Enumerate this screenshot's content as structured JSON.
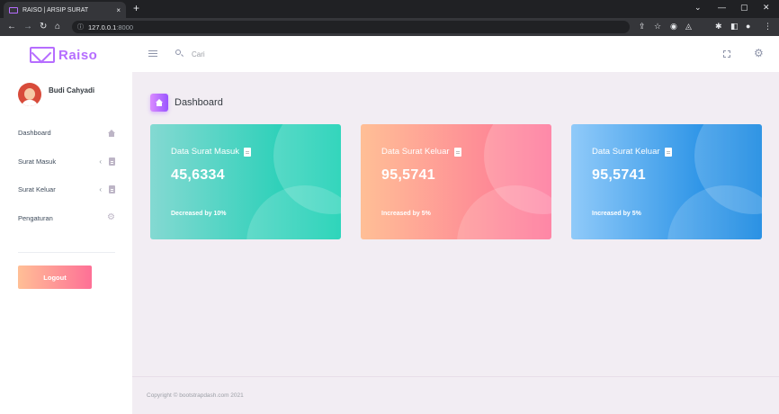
{
  "browser": {
    "tab_title": "RAISO | ARSIP SURAT",
    "tab_close": "×",
    "new_tab": "+",
    "url_host": "127.0.0.1",
    "url_port": ":8000",
    "window_controls": [
      "⌄",
      "—",
      "▢",
      "✕"
    ]
  },
  "sidebar": {
    "brand": "Raiso",
    "user_name": "Budi Cahyadi",
    "items": [
      {
        "label": "Dashboard",
        "icon": "home-icon",
        "has_chevron": false
      },
      {
        "label": "Surat Masuk",
        "icon": "file-icon",
        "has_chevron": true
      },
      {
        "label": "Surat Keluar",
        "icon": "file-icon",
        "has_chevron": true
      },
      {
        "label": "Pengaturan",
        "icon": "gear-icon",
        "has_chevron": false
      }
    ],
    "chevron": "‹",
    "logout_label": "Logout"
  },
  "navbar": {
    "search_placeholder": "Cari"
  },
  "page": {
    "title": "Dashboard"
  },
  "cards": [
    {
      "title": "Data Surat Masuk",
      "value": "45,6334",
      "note": "Decreased by 10%",
      "color_from": "#84d9d2",
      "color_to": "#07cdae"
    },
    {
      "title": "Data Surat Keluar",
      "value": "95,5741",
      "note": "Increased by 5%",
      "color_from": "#ffbf96",
      "color_to": "#fe7096"
    },
    {
      "title": "Data Surat Keluar",
      "value": "95,5741",
      "note": "Increased by 5%",
      "color_from": "#90caf9",
      "color_to": "#047edf"
    }
  ],
  "footer": {
    "copyright": "Copyright © bootstrapdash.com 2021"
  },
  "colors": {
    "accent": "#b66dff",
    "background": "#f2edf3"
  }
}
